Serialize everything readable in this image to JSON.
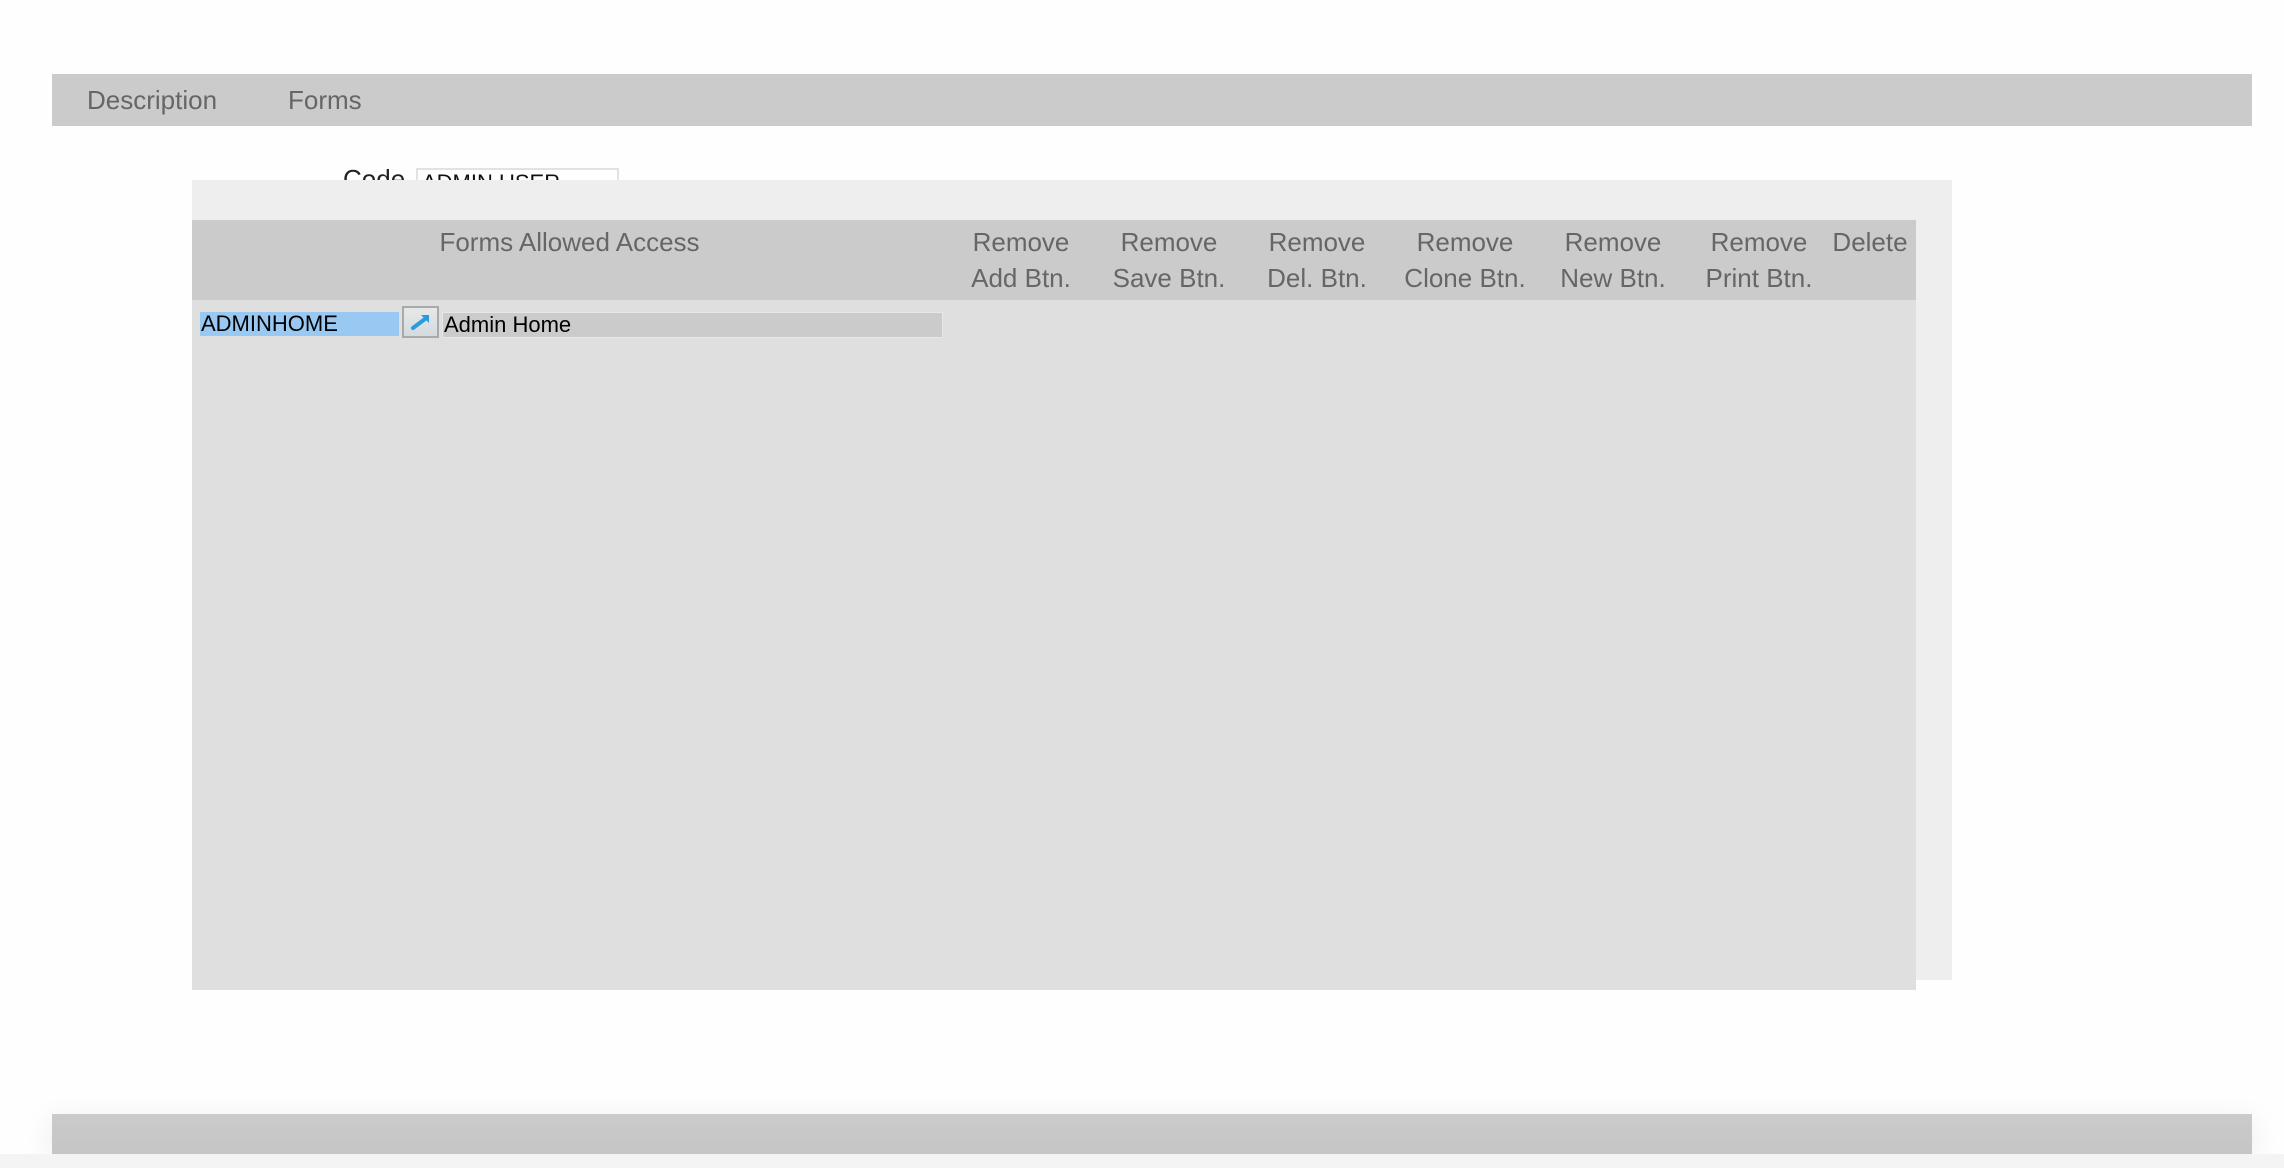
{
  "tabs": [
    {
      "label": "Description"
    },
    {
      "label": "Forms"
    }
  ],
  "code_field": {
    "label": "Code",
    "value": "ADMIN USER"
  },
  "grid": {
    "columns": [
      {
        "line1": "Forms Allowed Access",
        "line2": ""
      },
      {
        "line1": "Remove",
        "line2": "Add Btn."
      },
      {
        "line1": "Remove",
        "line2": "Save Btn."
      },
      {
        "line1": "Remove",
        "line2": "Del. Btn."
      },
      {
        "line1": "Remove",
        "line2": "Clone Btn."
      },
      {
        "line1": "Remove",
        "line2": "New Btn."
      },
      {
        "line1": "Remove",
        "line2": "Print Btn."
      },
      {
        "line1": "Delete",
        "line2": ""
      }
    ],
    "rows": [
      {
        "code": "ADMINHOME",
        "link_icon": "open-link-arrow-icon",
        "description": "Admin Home"
      }
    ]
  },
  "colors": {
    "tab_bar": "#cbcbcb",
    "header_text": "#666666",
    "grid_body": "#dfdfdf",
    "selection": "#99c9f2",
    "link_arrow": "#2a9bdf"
  }
}
